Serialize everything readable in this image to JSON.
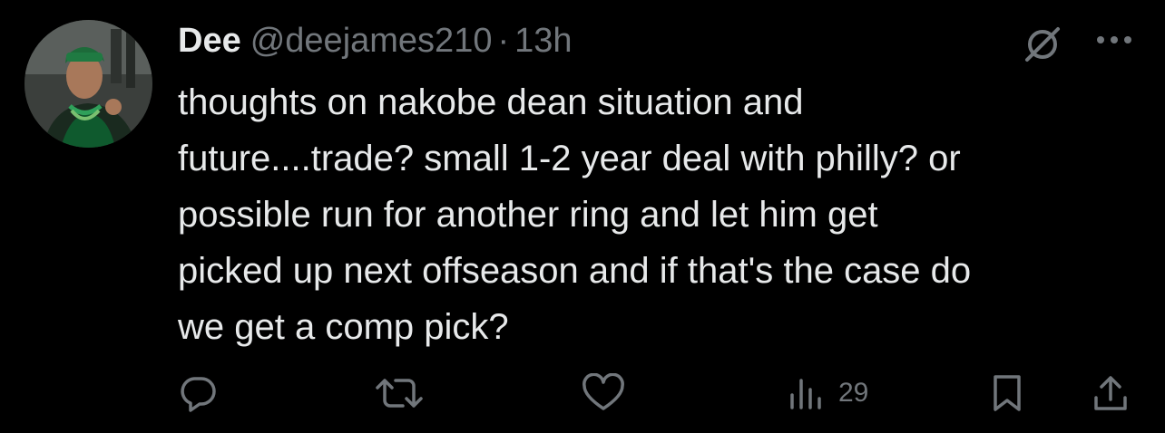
{
  "tweet": {
    "author": {
      "display_name": "Dee",
      "handle": "@deejames210",
      "separator": "·",
      "timestamp": "13h"
    },
    "body_lines": [
      "thoughts on nakobe dean situation and",
      "future....trade? small 1-2 year deal with philly? or",
      "possible run for another ring and let him get",
      "picked up next offseason and if that's the case do",
      "we get a comp pick?"
    ],
    "header_icons": [
      "grok-icon",
      "more-icon"
    ],
    "actions": {
      "reply": {
        "icon": "reply-icon"
      },
      "repost": {
        "icon": "repost-icon"
      },
      "like": {
        "icon": "like-icon"
      },
      "views": {
        "icon": "views-icon",
        "count": "29"
      },
      "bookmark": {
        "icon": "bookmark-icon"
      },
      "share": {
        "icon": "share-icon"
      }
    },
    "colors": {
      "background": "#000000",
      "text_primary": "#e7e9ea",
      "text_secondary": "#71767b"
    }
  }
}
